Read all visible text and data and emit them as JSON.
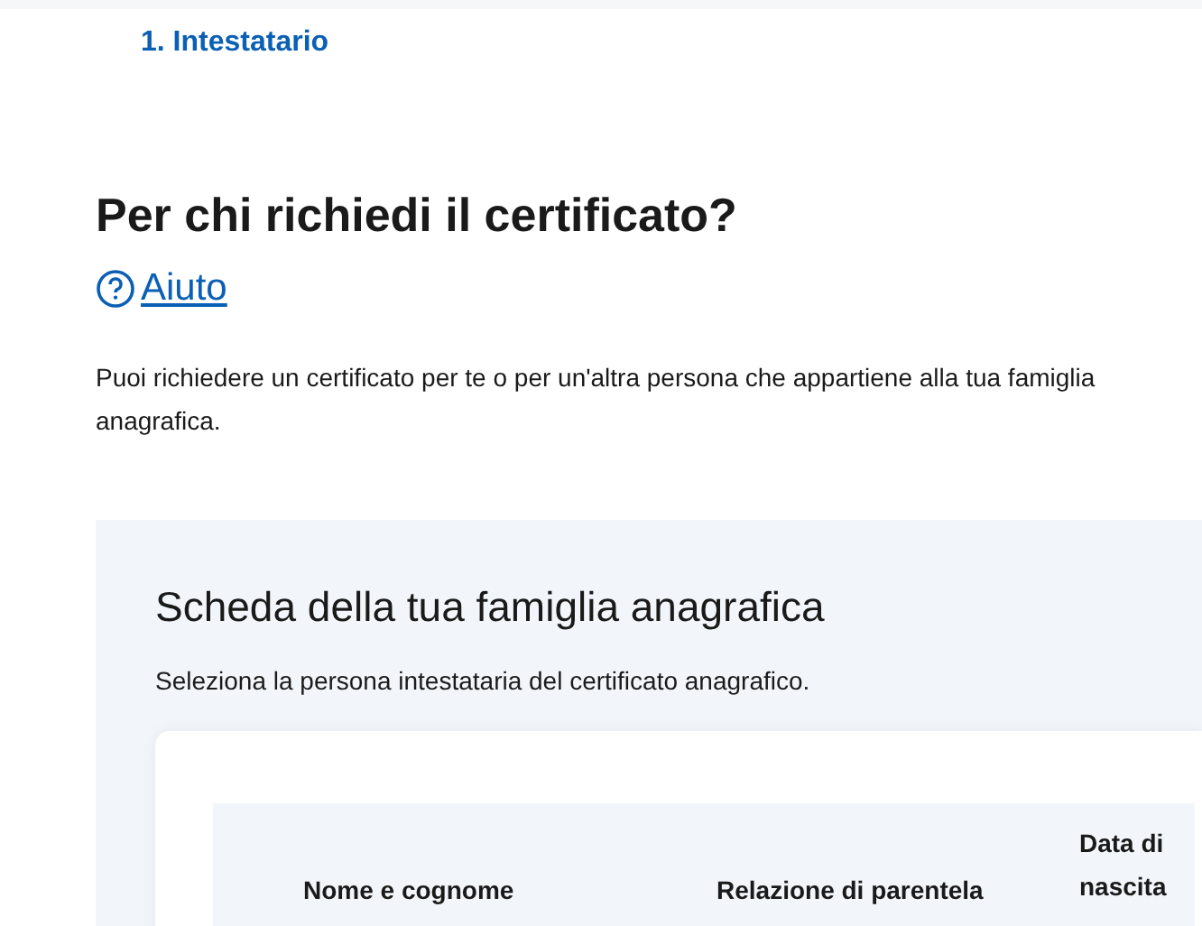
{
  "step": "1. Intestatario",
  "heading": "Per chi richiedi il certificato?",
  "help_link": "Aiuto",
  "intro": "Puoi richiedere un certificato per te o per un'altra persona che appartiene alla tua famiglia anagrafica.",
  "panel": {
    "title": "Scheda della tua famiglia anagrafica",
    "subtitle": "Seleziona la persona intestataria del certificato anagrafico.",
    "table": {
      "columns": [
        "Nome e cognome",
        "Relazione di parentela",
        "Data di nascita"
      ]
    }
  }
}
